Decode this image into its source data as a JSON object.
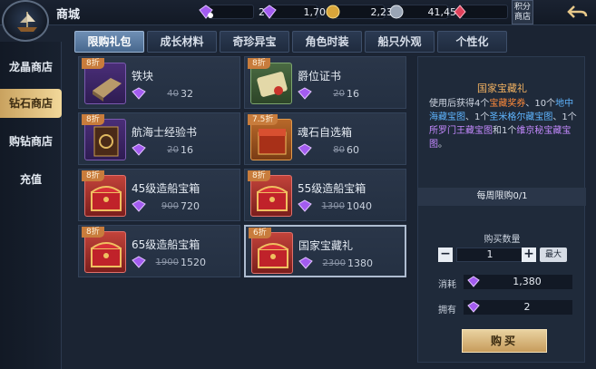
{
  "header": {
    "title": "商城",
    "currencies": [
      {
        "icon": "purple-gem-plus-icon",
        "value": "2"
      },
      {
        "icon": "purple-gem-icon",
        "value": "1,706"
      },
      {
        "icon": "gold-coin-icon",
        "value": "2,230"
      },
      {
        "icon": "silver-coin-icon",
        "value": "41,451"
      },
      {
        "icon": "red-crystal-icon",
        "value": "0"
      }
    ],
    "points_shop_label": "积分商店"
  },
  "sidebar": {
    "items": [
      {
        "label": "龙晶商店",
        "active": false
      },
      {
        "label": "钻石商店",
        "active": true
      },
      {
        "label": "购钻商店",
        "active": false
      },
      {
        "label": "充值",
        "active": false
      }
    ]
  },
  "tabs": [
    {
      "label": "限购礼包",
      "active": true
    },
    {
      "label": "成长材料",
      "active": false
    },
    {
      "label": "奇珍异宝",
      "active": false
    },
    {
      "label": "角色时装",
      "active": false
    },
    {
      "label": "船只外观",
      "active": false
    },
    {
      "label": "个性化",
      "active": false
    }
  ],
  "items": [
    {
      "discount": "8折",
      "name": "铁块",
      "old_price": "40",
      "price": "32",
      "color": "purple",
      "icon": "iron-block-icon"
    },
    {
      "discount": "8折",
      "name": "爵位证书",
      "old_price": "20",
      "price": "16",
      "color": "green",
      "icon": "certificate-icon"
    },
    {
      "discount": "8折",
      "name": "航海士经验书",
      "old_price": "20",
      "price": "16",
      "color": "purple",
      "icon": "exp-book-icon"
    },
    {
      "discount": "7.5折",
      "name": "魂石自选箱",
      "old_price": "80",
      "price": "60",
      "color": "orange",
      "icon": "soulstone-box-icon"
    },
    {
      "discount": "8折",
      "name": "45级造船宝箱",
      "old_price": "900",
      "price": "720",
      "color": "red",
      "icon": "treasure-chest-icon"
    },
    {
      "discount": "8折",
      "name": "55级造船宝箱",
      "old_price": "1300",
      "price": "1040",
      "color": "red",
      "icon": "treasure-chest-icon"
    },
    {
      "discount": "8折",
      "name": "65级造船宝箱",
      "old_price": "1900",
      "price": "1520",
      "color": "red",
      "icon": "treasure-chest-icon"
    },
    {
      "discount": "6折",
      "name": "国家宝藏礼",
      "old_price": "2300",
      "price": "1380",
      "color": "red",
      "icon": "treasure-chest-icon",
      "selected": true
    }
  ],
  "detail": {
    "title": "国家宝藏礼",
    "desc_parts": [
      {
        "text": "使用后获得4个",
        "color": ""
      },
      {
        "text": "宝藏奖券",
        "color": "orange"
      },
      {
        "text": "、10个",
        "color": ""
      },
      {
        "text": "地中海藏宝图",
        "color": "blue"
      },
      {
        "text": "、1个",
        "color": ""
      },
      {
        "text": "圣米格尔藏宝图",
        "color": "blue"
      },
      {
        "text": "、1个",
        "color": ""
      },
      {
        "text": "所罗门王藏宝图",
        "color": "purple"
      },
      {
        "text": "和1个",
        "color": ""
      },
      {
        "text": "维京秘宝藏宝图",
        "color": "purple"
      },
      {
        "text": "。",
        "color": ""
      }
    ],
    "weekly_limit": "每周限购0/1",
    "qty_label": "购买数量",
    "qty_minus": "−",
    "qty_value": "1",
    "qty_plus": "+",
    "max_label": "最大",
    "cost_label": "消耗",
    "cost_value": "1,380",
    "own_label": "拥有",
    "own_value": "2",
    "buy_label": "购买"
  }
}
